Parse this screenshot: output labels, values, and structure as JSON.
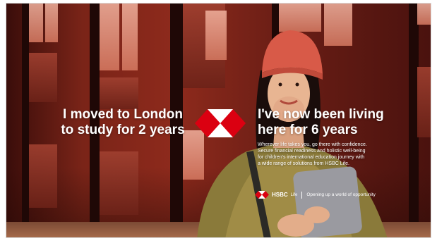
{
  "headline_left": {
    "line1": "I moved to London",
    "line2": "to study for 2 years"
  },
  "headline_right": {
    "line1": "I've now been living",
    "line2": "here for 6 years"
  },
  "body_copy": [
    "Wherever life takes you, go there with confidence.",
    "Secure financial readiness and holistic well-being",
    "for children's international education journey with",
    "a wide range of solutions from HSBC Life."
  ],
  "brand": {
    "name": "HSBC",
    "sub": "Life",
    "tagline": "Opening up a world of opportunity"
  },
  "colors": {
    "hsbc_red": "#db0011",
    "text": "#ffffff"
  }
}
